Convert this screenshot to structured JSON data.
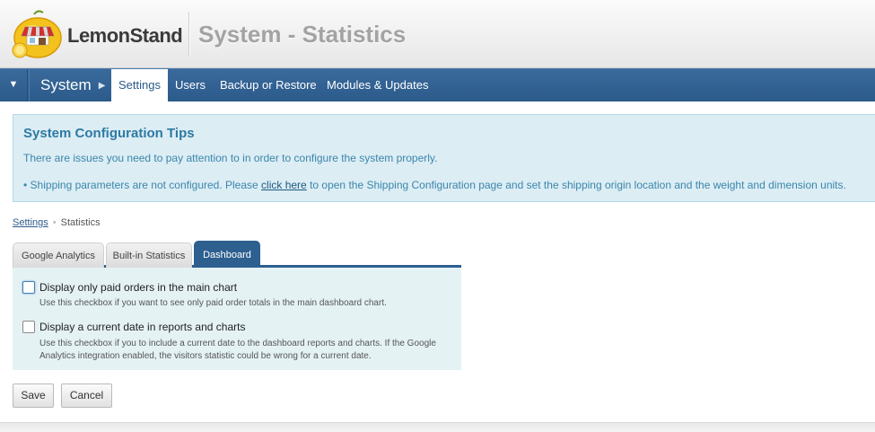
{
  "header": {
    "logo_text": "LemonStand",
    "page_title": "System - Statistics"
  },
  "nav": {
    "toggle_icon": "triangle-down",
    "section_label": "System",
    "section_arrow": "▶",
    "items": [
      {
        "label": "Settings",
        "active": true
      },
      {
        "label": "Users",
        "active": false
      },
      {
        "label": "Backup or Restore",
        "active": false
      },
      {
        "label": "Modules & Updates",
        "active": false
      }
    ]
  },
  "tips": {
    "title": "System Configuration Tips",
    "text": "There are issues you need to pay attention to in order to configure the system properly.",
    "bullet_before": "Shipping parameters are not configured. Please ",
    "bullet_link": "click here",
    "bullet_after": " to open the Shipping Configuration page and set the shipping origin location and the weight and dimension units."
  },
  "breadcrumb": {
    "parent": "Settings",
    "current": "Statistics"
  },
  "tabs": [
    {
      "label": "Google Analytics",
      "active": false
    },
    {
      "label": "Built-in Statistics",
      "active": false
    },
    {
      "label": "Dashboard",
      "active": true
    }
  ],
  "form": {
    "paid_orders": {
      "label": "Display only paid orders in the main chart",
      "hint": "Use this checkbox if you want to see only paid order totals in the main dashboard chart.",
      "checked": false
    },
    "current_date": {
      "label": "Display a current date in reports and charts",
      "hint": "Use this checkbox if you to include a current date to the dashboard reports and charts. If the Google Analytics integration enabled, the visitors statistic could be wrong for a current date.",
      "checked": false
    }
  },
  "buttons": {
    "save": "Save",
    "cancel": "Cancel"
  },
  "colors": {
    "nav_blue": "#2b5a8b",
    "tips_bg": "#dcedf4",
    "tips_text": "#3b86ab"
  }
}
